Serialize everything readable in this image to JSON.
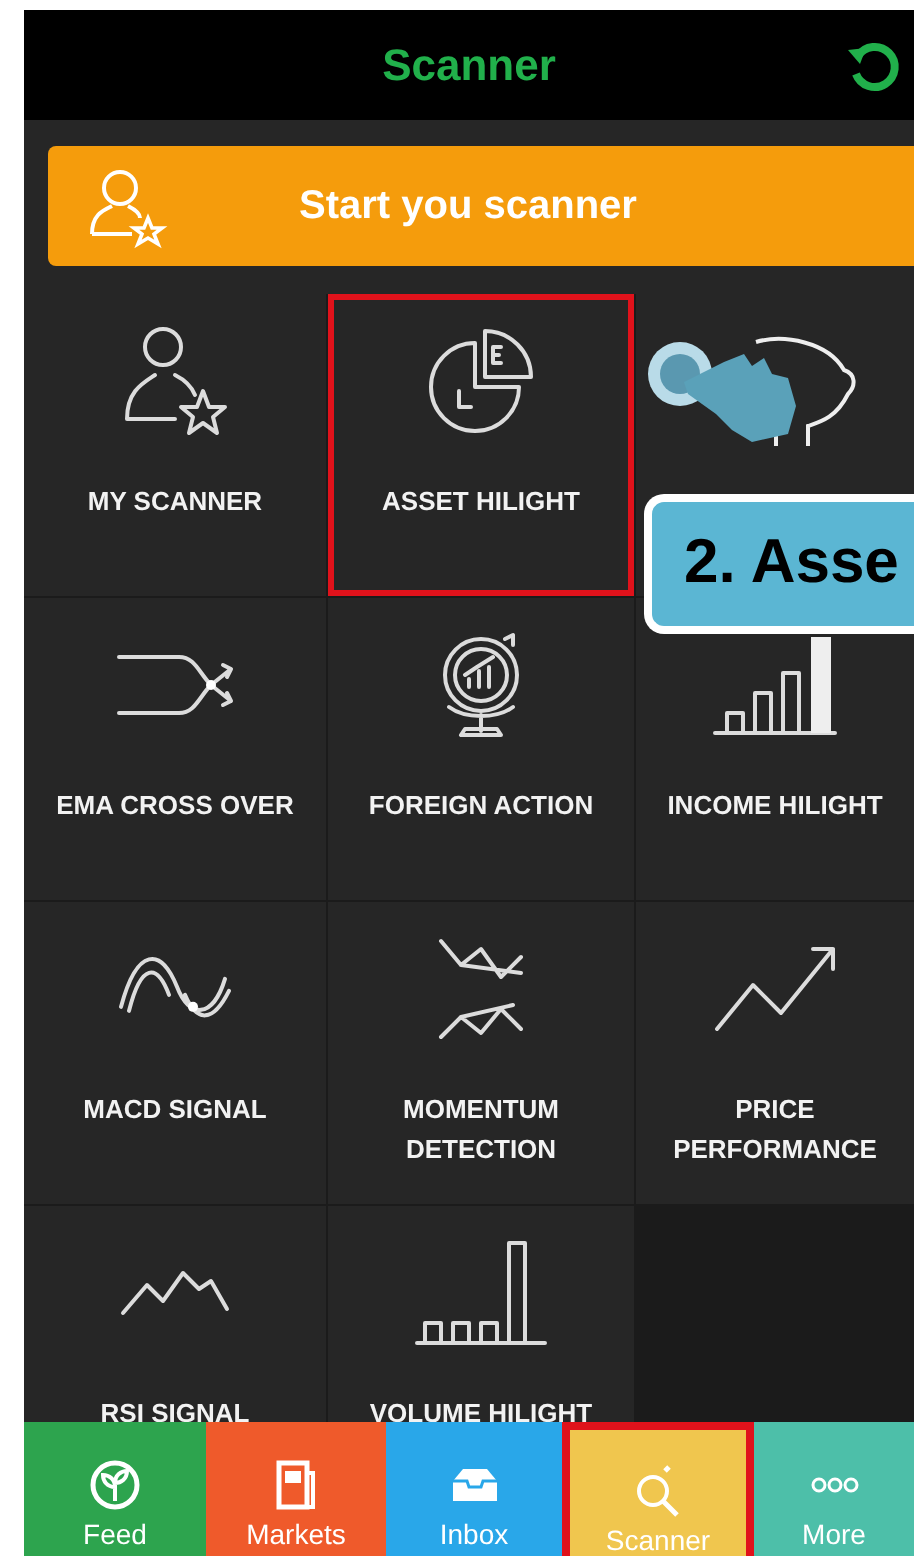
{
  "header": {
    "title": "Scanner"
  },
  "start_button": {
    "label": "Start you scanner"
  },
  "tiles": [
    {
      "kind": "tile",
      "label": "MY SCANNER",
      "selected": false
    },
    {
      "kind": "tile",
      "label": "ASSET HILIGHT",
      "selected": true
    },
    {
      "kind": "empty"
    },
    {
      "kind": "tile",
      "label": "EMA CROSS OVER",
      "selected": false
    },
    {
      "kind": "tile",
      "label": "FOREIGN ACTION",
      "selected": false
    },
    {
      "kind": "tile",
      "label": "INCOME HILIGHT",
      "selected": false
    },
    {
      "kind": "tile",
      "label": "MACD SIGNAL",
      "selected": false
    },
    {
      "kind": "tile",
      "label": "MOMENTUM DETECTION",
      "selected": false
    },
    {
      "kind": "tile",
      "label": "PRICE PERFORMANCE",
      "selected": false
    },
    {
      "kind": "tile",
      "label": "RSI SIGNAL",
      "selected": false
    },
    {
      "kind": "tile",
      "label": "VOLUME HILIGHT",
      "selected": false
    }
  ],
  "callout": {
    "text": "2. Asse"
  },
  "tabs": [
    {
      "label": "Feed",
      "color": "#2da44e",
      "selected": false
    },
    {
      "label": "Markets",
      "color": "#ef5a2b",
      "selected": false
    },
    {
      "label": "Inbox",
      "color": "#29a7e9",
      "selected": false
    },
    {
      "label": "Scanner",
      "color": "#f0c64e",
      "selected": true
    },
    {
      "label": "More",
      "color": "#4dbfa9",
      "selected": false
    }
  ]
}
